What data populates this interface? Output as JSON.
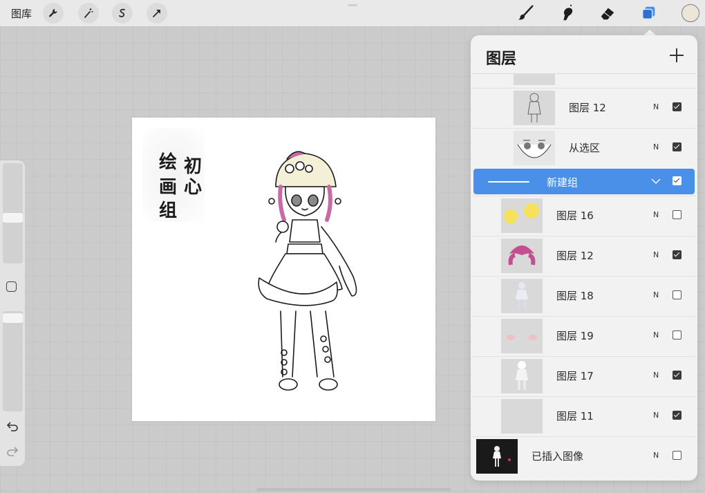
{
  "topbar": {
    "gallery_label": "图库",
    "left_tools": [
      "wrench-icon",
      "magic-wand-icon",
      "selection-icon",
      "transform-arrow-icon"
    ],
    "right_tools": [
      "brush-icon",
      "smudge-icon",
      "eraser-icon",
      "layers-icon"
    ],
    "color_well": "#ece6da"
  },
  "canvas": {
    "calligraphy": [
      "绘",
      "画",
      "组",
      "初",
      "心"
    ]
  },
  "layers_panel": {
    "title": "图层",
    "add_icon": "plus-icon",
    "layers": [
      {
        "name": "图层 12",
        "mode": "N",
        "visible": true
      },
      {
        "name": "从选区",
        "mode": "N",
        "visible": true
      }
    ],
    "group": {
      "name": "新建组",
      "visible": true,
      "accent": "#4a90e8"
    },
    "group_layers": [
      {
        "name": "图层 16",
        "mode": "N",
        "visible": false
      },
      {
        "name": "图层 12",
        "mode": "N",
        "visible": true
      },
      {
        "name": "图层 18",
        "mode": "N",
        "visible": false
      },
      {
        "name": "图层 19",
        "mode": "N",
        "visible": false
      },
      {
        "name": "图层 17",
        "mode": "N",
        "visible": true
      },
      {
        "name": "图层 11",
        "mode": "N",
        "visible": true
      }
    ],
    "bottom_layer": {
      "name": "已插入图像",
      "mode": "N",
      "visible": false
    }
  }
}
